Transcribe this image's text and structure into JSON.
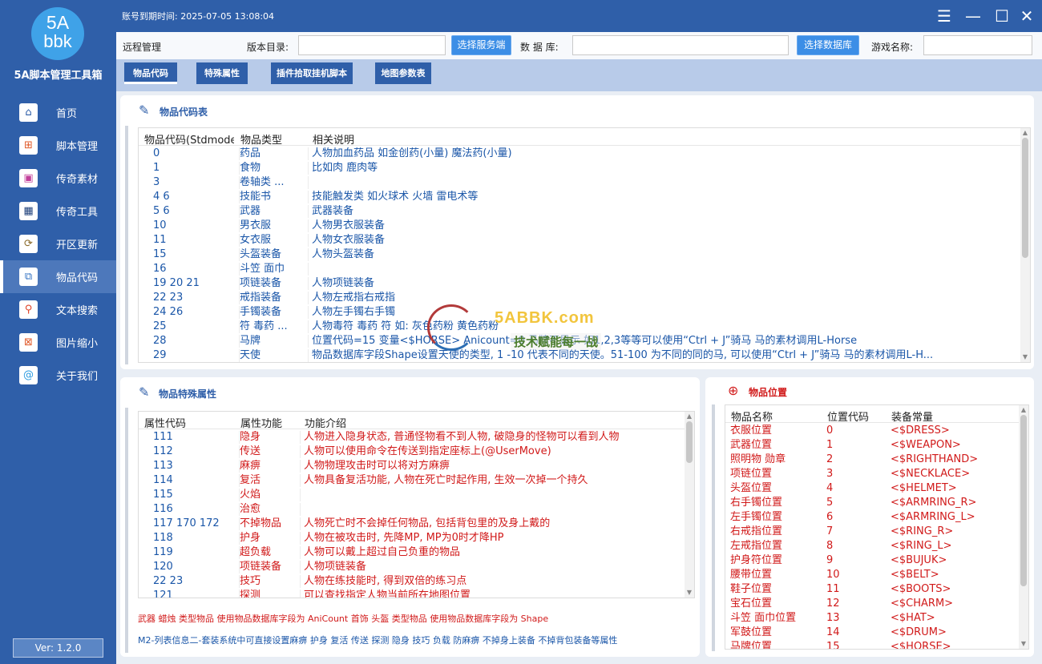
{
  "sidebar": {
    "logo_line1": "5A",
    "logo_line2": "bbk",
    "app_name": "5A脚本管理工具箱",
    "items": [
      {
        "label": "首页",
        "icon": "home-icon",
        "glyph": "⌂",
        "color": "#2f5fa9"
      },
      {
        "label": "脚本管理",
        "icon": "script-icon",
        "glyph": "⊞",
        "color": "#e05a2a"
      },
      {
        "label": "传奇素材",
        "icon": "image-icon",
        "glyph": "▣",
        "color": "#c2409a"
      },
      {
        "label": "传奇工具",
        "icon": "grid-icon",
        "glyph": "▦",
        "color": "#1d3f7a"
      },
      {
        "label": "开区更新",
        "icon": "update-icon",
        "glyph": "⟳",
        "color": "#8a6a2a"
      },
      {
        "label": "物品代码",
        "icon": "item-code-icon",
        "glyph": "⧉",
        "color": "#2f6fc1"
      },
      {
        "label": "文本搜索",
        "icon": "search-icon",
        "glyph": "⚲",
        "color": "#e0452a"
      },
      {
        "label": "图片缩小",
        "icon": "shrink-icon",
        "glyph": "⊠",
        "color": "#e05a2a"
      },
      {
        "label": "关于我们",
        "icon": "about-icon",
        "glyph": "@",
        "color": "#2a9ae0"
      }
    ],
    "active_index": 5,
    "version": "Ver: 1.2.0"
  },
  "topbar": {
    "expire_text": "账号到期时间: 2025-07-05 13:08:04",
    "menu_glyph": "☰",
    "min_glyph": "—",
    "max_glyph": "☐",
    "close_glyph": "✕"
  },
  "config": {
    "remote_label": "远程管理",
    "version_dir_label": "版本目录:",
    "version_dir_value": "",
    "select_server_btn": "选择服务端",
    "database_label": "数 据 库:",
    "database_value": "",
    "select_db_btn": "选择数据库",
    "game_name_label": "游戏名称:",
    "game_name_value": ""
  },
  "tabs": [
    "物品代码",
    "特殊属性",
    "插件拾取挂机脚本",
    "地图参数表"
  ],
  "item_code_panel": {
    "title": "物品代码表",
    "columns": [
      "物品代码(Stdmode)",
      "物品类型",
      "相关说明"
    ],
    "rows": [
      [
        "0",
        "药品",
        "人物加血药品 如金创药(小量) 魔法药(小量)"
      ],
      [
        "1",
        "食物",
        "比如肉 鹿肉等"
      ],
      [
        "3",
        "卷轴类 ...",
        ""
      ],
      [
        "4 6",
        "技能书",
        "技能触发类 如火球术 火墙 雷电术等"
      ],
      [
        "5 6",
        "武器",
        "武器装备"
      ],
      [
        "10",
        "男衣服",
        "人物男衣服装备"
      ],
      [
        "11",
        "女衣服",
        "人物女衣服装备"
      ],
      [
        "15",
        "头盔装备",
        "人物头盔装备"
      ],
      [
        "16",
        "斗笠 面巾",
        ""
      ],
      [
        "19 20 21",
        "项链装备",
        "人物项链装备"
      ],
      [
        "22 23",
        "戒指装备",
        "人物左戒指右戒指"
      ],
      [
        "24 26",
        "手镯装备",
        "人物左手镯右手镯"
      ],
      [
        "25",
        "符 毒药 ...",
        "人物毒符 毒药 符 如: 灰色药粉 黄色药粉"
      ],
      [
        "28",
        "马牌",
        "位置代码=15 变量<$HORSE> Anicount=0 马牌不显示 如1,2,3等等可以使用“Ctrl + J”骑马 马的素材调用L-Horse"
      ],
      [
        "29",
        "天使",
        "物品数据库字段Shape设置天使的类型, 1 -10 代表不同的天使。51-100 为不同的同的马, 可以使用“Ctrl + J”骑马 马的素材调用L-H..."
      ]
    ]
  },
  "special_panel": {
    "title": "物品特殊属性",
    "columns": [
      "属性代码",
      "属性功能",
      "功能介绍"
    ],
    "rows": [
      [
        "111",
        "隐身",
        "人物进入隐身状态, 普通怪物看不到人物, 破隐身的怪物可以看到人物"
      ],
      [
        "112",
        "传送",
        "人物可以使用命令在传送到指定座标上(@UserMove)"
      ],
      [
        "113",
        "麻痹",
        "人物物理攻击时可以将对方麻痹"
      ],
      [
        "114",
        "复活",
        "人物具备复活功能, 人物在死亡时起作用, 生效一次掉一个持久"
      ],
      [
        "115",
        "火焰",
        ""
      ],
      [
        "116",
        "治愈",
        ""
      ],
      [
        "117 170 172",
        "不掉物品",
        "人物死亡时不会掉任何物品, 包括背包里的及身上戴的"
      ],
      [
        "118",
        "护身",
        "人物在被攻击时, 先降MP, MP为0时才降HP"
      ],
      [
        "119",
        "超负载",
        "人物可以戴上超过自己负重的物品"
      ],
      [
        "120",
        "项链装备",
        "人物项链装备"
      ],
      [
        "22 23",
        "技巧",
        "人物在练技能时, 得到双倍的练习点"
      ],
      [
        "121",
        "探测",
        "可以查找指定人物当前所在地图位置"
      ]
    ],
    "note_red": "武器 蜡烛 类型物品 使用物品数据库字段为 AniCount 首饰 头盔 类型物品 使用物品数据库字段为 Shape",
    "note_blue": "M2-列表信息二-套装系统中可直接设置麻痹 护身 复活 传送 探测 隐身 技巧 负载 防麻痹 不掉身上装备 不掉背包装备等属性"
  },
  "position_panel": {
    "title": "物品位置",
    "columns": [
      "物品名称",
      "位置代码",
      "装备常量"
    ],
    "rows": [
      [
        "衣服位置",
        "0",
        "<$DRESS>"
      ],
      [
        "武器位置",
        "1",
        "<$WEAPON>"
      ],
      [
        "照明物 勋章",
        "2",
        "<$RIGHTHAND>"
      ],
      [
        "项链位置",
        "3",
        "<$NECKLACE>"
      ],
      [
        "头盔位置",
        "4",
        "<$HELMET>"
      ],
      [
        "右手镯位置",
        "5",
        "<$ARMRING_R>"
      ],
      [
        "左手镯位置",
        "6",
        "<$ARMRING_L>"
      ],
      [
        "右戒指位置",
        "7",
        "<$RING_R>"
      ],
      [
        "左戒指位置",
        "8",
        "<$RING_L>"
      ],
      [
        "护身符位置",
        "9",
        "<$BUJUK>"
      ],
      [
        "腰带位置",
        "10",
        "<$BELT>"
      ],
      [
        "鞋子位置",
        "11",
        "<$BOOTS>"
      ],
      [
        "宝石位置",
        "12",
        "<$CHARM>"
      ],
      [
        "斗笠 面巾位置",
        "13",
        "<$HAT>"
      ],
      [
        "军鼓位置",
        "14",
        "<$DRUM>"
      ],
      [
        "马牌位置",
        "15",
        "<$HORSE>"
      ]
    ]
  },
  "watermark": {
    "site": "5ABBK.com",
    "slogan": "技术赋能每一战"
  },
  "colors": {
    "sidebar_bg": "#2f5fa9",
    "row_blue": "#1a56a8",
    "row_red": "#d11a1a",
    "accent_button": "#3c8ee6"
  }
}
